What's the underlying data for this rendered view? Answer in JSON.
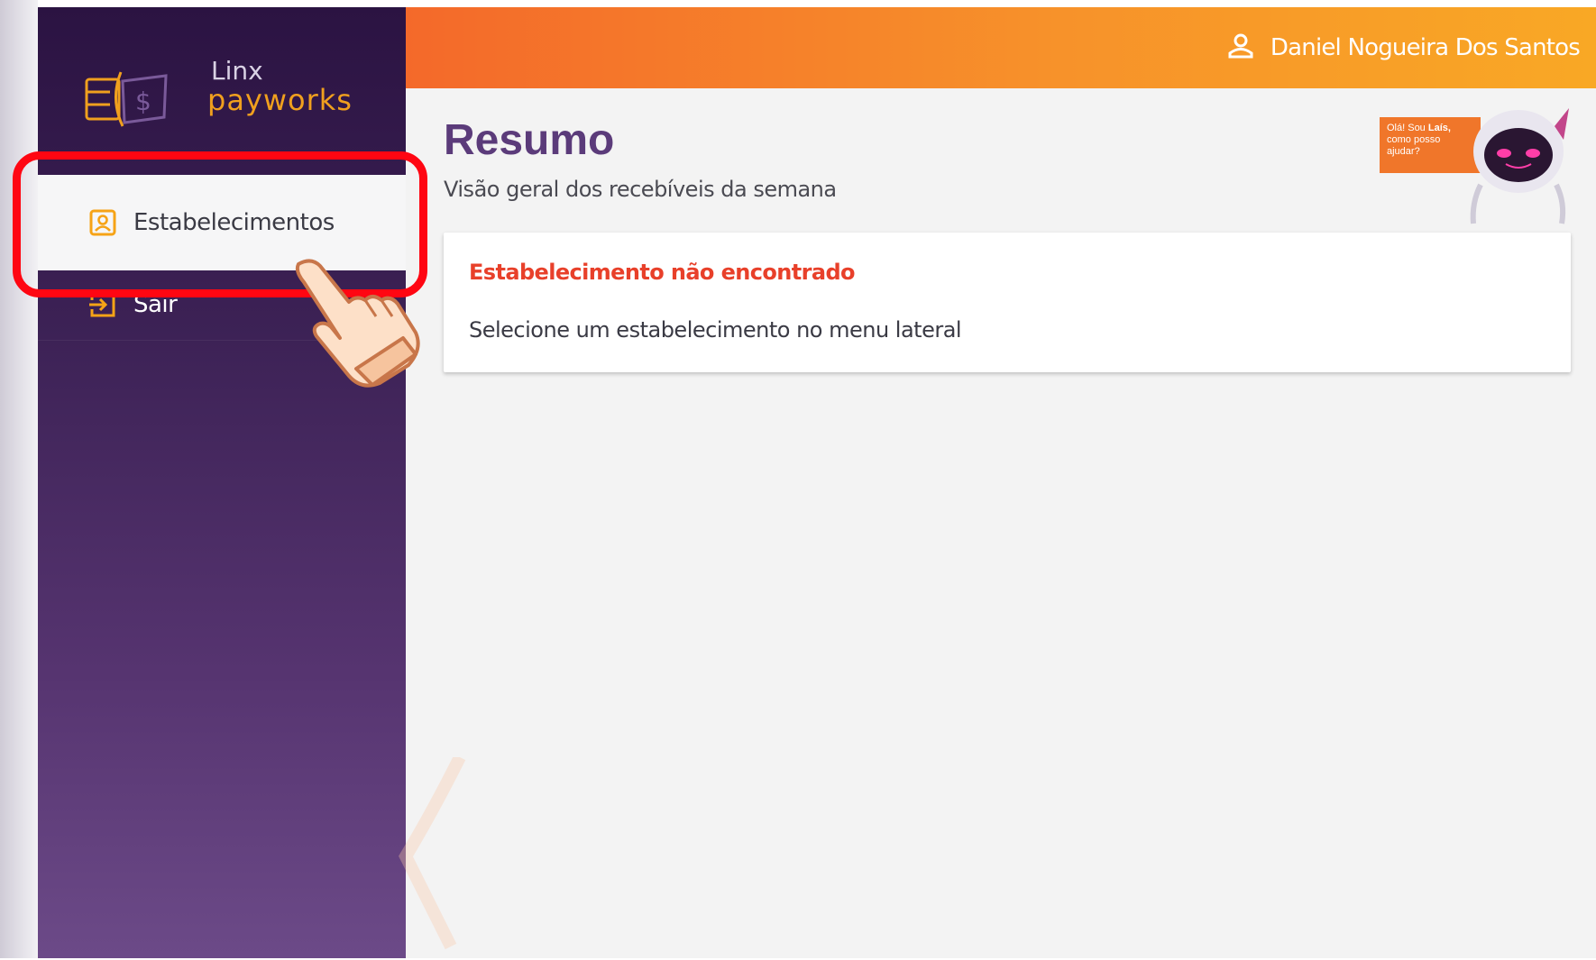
{
  "brand": {
    "logo_top": "Linx",
    "logo_bottom": "payworks"
  },
  "sidebar": {
    "items": [
      {
        "label": "Estabelecimentos",
        "icon": "store-badge-icon",
        "active": true
      },
      {
        "label": "Sair",
        "icon": "exit-icon",
        "active": false
      }
    ]
  },
  "header": {
    "user_name": "Daniel Nogueira Dos Santos",
    "user_icon": "user-icon"
  },
  "main": {
    "title": "Resumo",
    "subtitle": "Visão geral dos recebíveis da semana",
    "card": {
      "title": "Estabelecimento não encontrado",
      "message": "Selecione um estabelecimento no menu lateral"
    }
  },
  "assistant": {
    "line1": "Olá! Sou ",
    "name": "Laís,",
    "line2": "como posso",
    "line3": "ajudar?"
  },
  "colors": {
    "sidebar_top": "#2b1342",
    "sidebar_bottom": "#6c4a88",
    "header_start": "#f4692a",
    "header_end": "#f9a825",
    "title": "#5b3b7a",
    "error": "#e8402a",
    "icon_accent": "#f6a316",
    "highlight": "#ff0612"
  }
}
